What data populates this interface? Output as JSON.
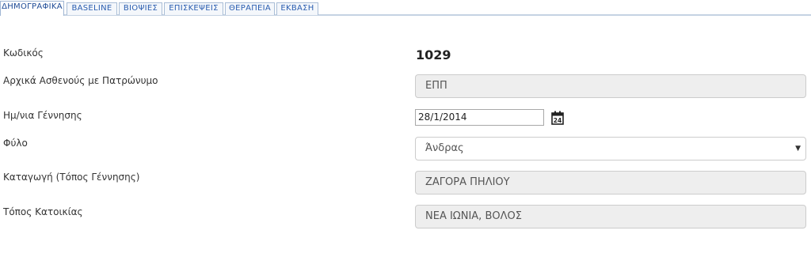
{
  "tabs": [
    {
      "label": "ΔΗΜΟΓΡΑΦΙΚΑ",
      "active": true
    },
    {
      "label": "BASELINE",
      "active": false
    },
    {
      "label": "ΒΙΟΨΙΕΣ",
      "active": false
    },
    {
      "label": "ΕΠΙΣΚΕΨΕΙΣ",
      "active": false
    },
    {
      "label": "ΘΕΡΑΠΕΙΑ",
      "active": false
    },
    {
      "label": "ΕΚΒΑΣΗ",
      "active": false
    }
  ],
  "form": {
    "code": {
      "label": "Κωδικός",
      "value": "1029"
    },
    "initials": {
      "label": "Αρχικά Ασθενούς με Πατρώνυμο",
      "value": "ΕΠΠ"
    },
    "birth_date": {
      "label": "Ημ/νια Γέννησης",
      "value": "28/1/2014",
      "calendar_day": "24",
      "icon": "calendar-icon"
    },
    "sex": {
      "label": "Φύλο",
      "value": "Άνδρας",
      "icon": "dropdown-caret"
    },
    "origin": {
      "label": "Καταγωγή (Τόπος Γέννησης)",
      "value": "ΖΑΓΟΡΑ ΠΗΛΙΟΥ"
    },
    "residence": {
      "label": "Τόπος Κατοικίας",
      "value": "ΝΕΑ ΙΩΝΙΑ, ΒΟΛΟΣ"
    }
  },
  "colors": {
    "tab_text": "#2a5db0",
    "tab_border": "#a9bdd6",
    "readonly_bg": "#eeeeee",
    "field_border": "#cccccc"
  }
}
